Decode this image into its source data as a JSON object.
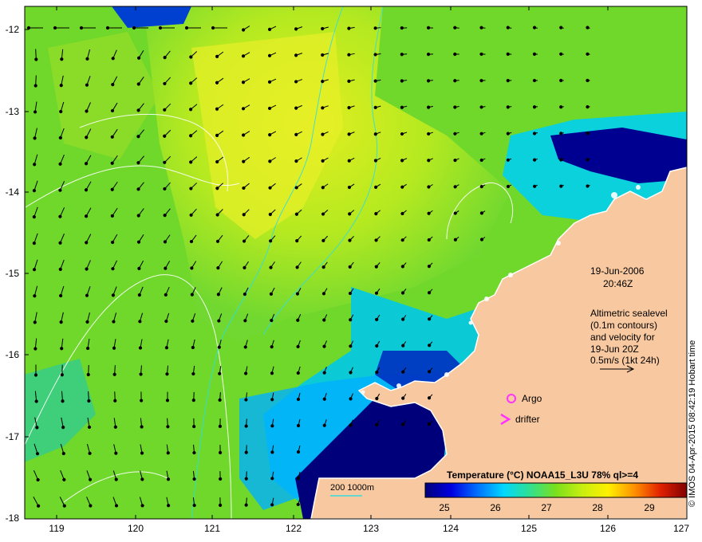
{
  "map": {
    "y_ticks": [
      "-12",
      "-13",
      "-14",
      "-15",
      "-16",
      "-17",
      "-18"
    ],
    "x_ticks": [
      "119",
      "120",
      "121",
      "122",
      "123",
      "124",
      "125",
      "126",
      "127"
    ],
    "colors": {
      "land": "#f8c9a0",
      "cold": "#00007a",
      "mid": "#00c8ff",
      "warm": "#7be01c",
      "hot": "#e0f020",
      "contour": "#ffffff",
      "bathy": "#33dddd",
      "marker": "#ff33ff"
    }
  },
  "annotations": {
    "date": "19-Jun-2006",
    "time": "20:46Z",
    "info_line1": "Altimetric sealevel",
    "info_line2": "(0.1m contours)",
    "info_line3": "and velocity for",
    "info_line4": "19-Jun 20Z",
    "velocity_scale": "0.5m/s (1kt 24h)",
    "argo": "Argo",
    "drifter": "drifter",
    "bathy_label": "200  1000m"
  },
  "colorbar": {
    "title": "Temperature (°C) NOAA15_L3U 78% ql>=4",
    "ticks": [
      "25",
      "26",
      "27",
      "28",
      "29"
    ],
    "stops": [
      "#00007a",
      "#0000e0",
      "#0070ff",
      "#00d8ff",
      "#30e090",
      "#7be01c",
      "#c8ee10",
      "#fff000",
      "#ff9000",
      "#e02000",
      "#800000"
    ]
  },
  "credit": "© IMOS 04-Apr-2015 08:42:19 Hobart time"
}
